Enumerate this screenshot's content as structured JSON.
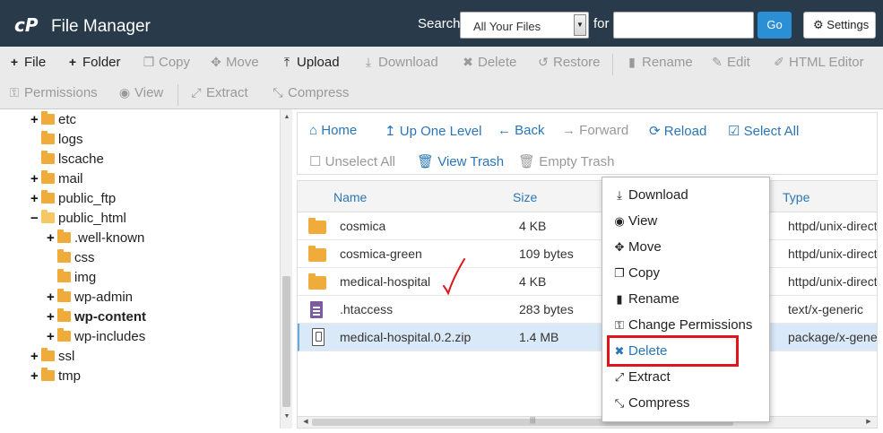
{
  "header": {
    "title": "File Manager",
    "search_label": "Search",
    "search_scope": "All Your Files",
    "for_label": "for",
    "search_value": "",
    "go_label": "Go",
    "settings_label": "Settings",
    "bg_color": "#293a4a"
  },
  "toolbar": {
    "file": "File",
    "folder": "Folder",
    "copy": "Copy",
    "move": "Move",
    "upload": "Upload",
    "download": "Download",
    "delete": "Delete",
    "restore": "Restore",
    "rename": "Rename",
    "edit": "Edit",
    "html_editor": "HTML Editor",
    "permissions": "Permissions",
    "view": "View",
    "extract": "Extract",
    "compress": "Compress"
  },
  "tree": {
    "items": [
      {
        "label": "etc",
        "toggle": "+"
      },
      {
        "label": "logs",
        "toggle": ""
      },
      {
        "label": "lscache",
        "toggle": ""
      },
      {
        "label": "mail",
        "toggle": "+"
      },
      {
        "label": "public_ftp",
        "toggle": "+"
      },
      {
        "label": "public_html",
        "toggle": "−"
      },
      {
        "label": ".well-known",
        "toggle": "+"
      },
      {
        "label": "css",
        "toggle": ""
      },
      {
        "label": "img",
        "toggle": ""
      },
      {
        "label": "wp-admin",
        "toggle": "+"
      },
      {
        "label": "wp-content",
        "toggle": "+"
      },
      {
        "label": "wp-includes",
        "toggle": "+"
      },
      {
        "label": "ssl",
        "toggle": "+"
      },
      {
        "label": "tmp",
        "toggle": "+"
      }
    ]
  },
  "nav": {
    "home": "Home",
    "up_one_level": "Up One Level",
    "back": "Back",
    "forward": "Forward",
    "reload": "Reload",
    "select_all": "Select All",
    "unselect_all": "Unselect All",
    "view_trash": "View Trash",
    "empty_trash": "Empty Trash"
  },
  "table": {
    "columns": {
      "name": "Name",
      "size": "Size",
      "type": "Type"
    },
    "rows": [
      {
        "name": "cosmica",
        "size": "4 KB",
        "type": "httpd/unix-directory",
        "icon": "folder-icon"
      },
      {
        "name": "cosmica-green",
        "size": "109 bytes",
        "type": "httpd/unix-directory",
        "icon": "folder-icon"
      },
      {
        "name": "medical-hospital",
        "size": "4 KB",
        "type": "httpd/unix-directory",
        "icon": "folder-icon"
      },
      {
        "name": ".htaccess",
        "size": "283 bytes",
        "type": "text/x-generic",
        "icon": "text-file-icon"
      },
      {
        "name": "medical-hospital.0.2.zip",
        "size": "1.4 MB",
        "type": "package/x-generic",
        "icon": "zip-file-icon"
      }
    ]
  },
  "context_menu": {
    "download": "Download",
    "view": "View",
    "move": "Move",
    "copy": "Copy",
    "rename": "Rename",
    "change_permissions": "Change Permissions",
    "delete": "Delete",
    "extract": "Extract",
    "compress": "Compress",
    "highlight_color": "#e0141b"
  }
}
